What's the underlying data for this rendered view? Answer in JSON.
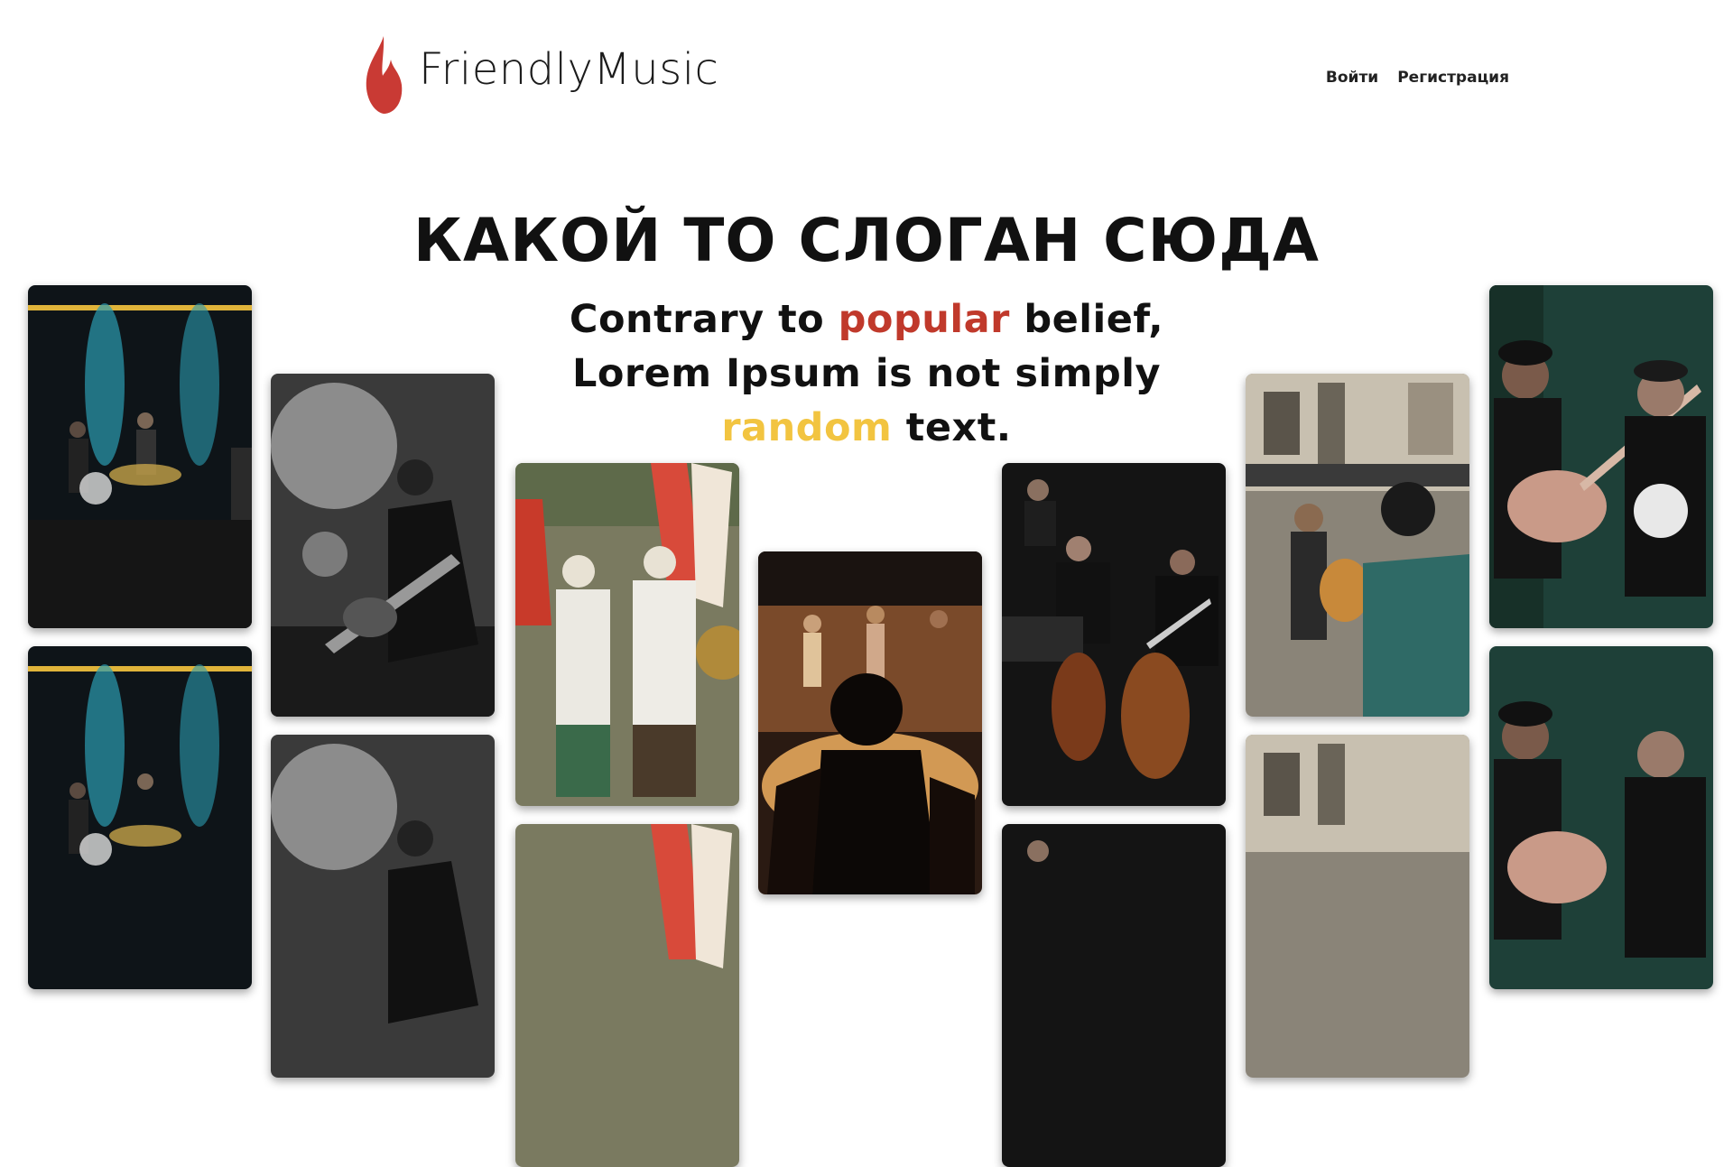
{
  "brand": {
    "name": "FriendlyMusic",
    "color": "#c93a34"
  },
  "nav": {
    "login": "Войти",
    "register": "Регистрация"
  },
  "hero": {
    "title": "КАКОЙ ТО СЛОГАН СЮДА",
    "sub_part1": "Contrary to ",
    "sub_red": "popular",
    "sub_part2": " belief, Lorem Ipsum is not simply ",
    "sub_yellow": "random",
    "sub_part3": " text.",
    "accent_red": "#c0392b",
    "accent_yellow": "#f2c440"
  },
  "gallery": [
    {
      "name": "concert-band-stage-photo"
    },
    {
      "name": "guitarist-black-white-photo"
    },
    {
      "name": "street-parade-photo"
    },
    {
      "name": "theater-stage-crowd-photo"
    },
    {
      "name": "orchestra-cellists-photo"
    },
    {
      "name": "street-musicians-photo"
    },
    {
      "name": "acoustic-guitar-duo-photo"
    }
  ]
}
